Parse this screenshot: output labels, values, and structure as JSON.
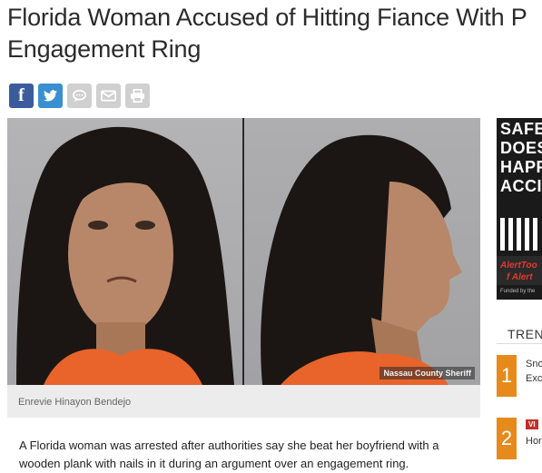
{
  "article": {
    "headline_line1": "Florida Woman Accused of Hitting Fiance With P",
    "headline_line2": "Engagement Ring",
    "photo_caption": "Enrevie Hinayon Bendejo",
    "photo_credit": "Nassau County Sheriff",
    "body_line1": "A Florida woman was arrested after authorities say she beat her boyfriend with a",
    "body_line2": "wooden plank with nails in it during an argument over an engagement ring."
  },
  "share": {
    "facebook_glyph": "f",
    "twitter_glyph": "t",
    "icons": [
      "facebook-icon",
      "twitter-icon",
      "comment-icon",
      "email-icon",
      "print-icon"
    ]
  },
  "ad": {
    "text": "SAFE\nDOES\nHAPP\nACCI",
    "brand_line1": "AlertToo",
    "brand_line2": "f Alert",
    "funded": "Funded by the"
  },
  "sidebar": {
    "trending_label": "TREN",
    "items": [
      {
        "rank": "1",
        "line1": "Sno",
        "line2": "Exc"
      },
      {
        "rank": "2",
        "badge": "VI",
        "line1": "Hor"
      }
    ]
  },
  "colors": {
    "facebook": "#3b5b9d",
    "twitter": "#3a8fd0",
    "trending_number": "#e68a1c",
    "video_badge": "#c0302a"
  }
}
